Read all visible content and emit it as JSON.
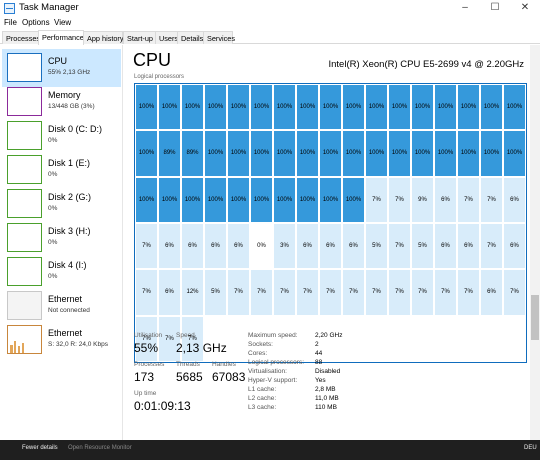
{
  "window": {
    "title": "Task Manager",
    "minimize": "–",
    "maximize": "☐",
    "close": "✕"
  },
  "menu": [
    "File",
    "Options",
    "View"
  ],
  "tabs": [
    "Processes",
    "Performance",
    "App history",
    "Start-up",
    "Users",
    "Details",
    "Services"
  ],
  "sidebar": [
    {
      "title": "CPU",
      "sub": "55% 2,13 GHz",
      "border": "#1a6fbf"
    },
    {
      "title": "Memory",
      "sub": "13/448 GB (3%)",
      "border": "#8b2a9a"
    },
    {
      "title": "Disk 0 (C: D:)",
      "sub": "0%",
      "border": "#4aa02c"
    },
    {
      "title": "Disk 1 (E:)",
      "sub": "0%",
      "border": "#4aa02c"
    },
    {
      "title": "Disk 2 (G:)",
      "sub": "0%",
      "border": "#4aa02c"
    },
    {
      "title": "Disk 3 (H:)",
      "sub": "0%",
      "border": "#4aa02c"
    },
    {
      "title": "Disk 4 (I:)",
      "sub": "0%",
      "border": "#4aa02c"
    },
    {
      "title": "Ethernet",
      "sub": "Not connected",
      "border": "#c8c8c8"
    },
    {
      "title": "Ethernet",
      "sub": "S: 32,0 R: 24,0 Kbps",
      "border": "#c8863c"
    }
  ],
  "main": {
    "title": "CPU",
    "model": "Intel(R) Xeon(R) CPU E5-2699 v4 @ 2.20GHz",
    "lp_label": "Logical processors"
  },
  "grid_rows": [
    [
      "100%",
      "100%",
      "100%",
      "100%",
      "100%",
      "100%",
      "100%",
      "100%",
      "100%",
      "100%",
      "100%",
      "100%",
      "100%",
      "100%",
      "100%",
      "100%",
      "100%"
    ],
    [
      "100%",
      "89%",
      "89%",
      "100%",
      "100%",
      "100%",
      "100%",
      "100%",
      "100%",
      "100%",
      "100%",
      "100%",
      "100%",
      "100%",
      "100%",
      "100%",
      "100%"
    ],
    [
      "100%",
      "100%",
      "100%",
      "100%",
      "100%",
      "100%",
      "100%",
      "100%",
      "100%",
      "100%",
      "7%",
      "7%",
      "9%",
      "6%",
      "7%",
      "7%",
      "6%"
    ],
    [
      "7%",
      "6%",
      "6%",
      "6%",
      "6%",
      "0%",
      "3%",
      "6%",
      "6%",
      "6%",
      "5%",
      "7%",
      "5%",
      "6%",
      "6%",
      "7%",
      "6%"
    ],
    [
      "7%",
      "6%",
      "12%",
      "5%",
      "7%",
      "7%",
      "7%",
      "7%",
      "7%",
      "7%",
      "7%",
      "7%",
      "7%",
      "7%",
      "7%",
      "6%",
      "7%"
    ],
    [
      "7%",
      "7%",
      "7%"
    ]
  ],
  "colors": {
    "high": "#3599db",
    "low": "#d8ecfa",
    "zero": "#ffffff",
    "accent": "#0f6cbd"
  },
  "stats": {
    "utilisation_label": "Utilisation",
    "utilisation": "55%",
    "speed_label": "Speed",
    "speed": "2,13 GHz",
    "processes_label": "Processes",
    "processes": "173",
    "threads_label": "Threads",
    "threads": "5685",
    "handles_label": "Handles",
    "handles": "67083",
    "uptime_label": "Up time",
    "uptime": "0:01:09:13"
  },
  "specs": [
    {
      "k": "Maximum speed:",
      "v": "2,20 GHz"
    },
    {
      "k": "Sockets:",
      "v": "2"
    },
    {
      "k": "Cores:",
      "v": "44"
    },
    {
      "k": "Logical processors:",
      "v": "88"
    },
    {
      "k": "Virtualisation:",
      "v": "Disabled"
    },
    {
      "k": "Hyper-V support:",
      "v": "Yes"
    },
    {
      "k": "L1 cache:",
      "v": "2,8 MB"
    },
    {
      "k": "L2 cache:",
      "v": "11,0 MB"
    },
    {
      "k": "L3 cache:",
      "v": "110 MB"
    }
  ],
  "taskbar": {
    "left_text": "Fewer details",
    "mid_text": "Open Resource Monitor",
    "right_text": "DEU"
  }
}
